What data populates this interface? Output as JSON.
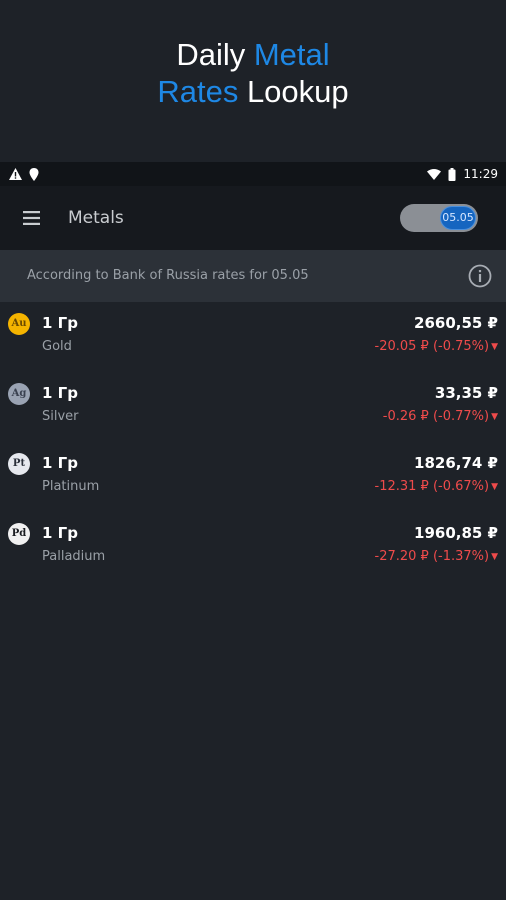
{
  "promo": {
    "line1_a": "Daily ",
    "line1_b": "Metal",
    "line2_a": "Rates",
    "line2_b": " Lookup"
  },
  "status": {
    "time": "11:29"
  },
  "appbar": {
    "title": "Metals",
    "date_toggle": "05.05"
  },
  "info": {
    "text": "According to Bank of Russia rates for 05.05"
  },
  "metals": [
    {
      "symbol": "Au",
      "qty": "1 Гр",
      "name": "Gold",
      "price": "2660,55 ₽",
      "change": "-20.05 ₽ (-0.75%)",
      "badge_bg": "#f5b400",
      "badge_fg": "#6b4a00"
    },
    {
      "symbol": "Ag",
      "qty": "1 Гр",
      "name": "Silver",
      "price": "33,35 ₽",
      "change": "-0.26 ₽ (-0.77%)",
      "badge_bg": "#9aa3b3",
      "badge_fg": "#3a4150"
    },
    {
      "symbol": "Pt",
      "qty": "1 Гр",
      "name": "Platinum",
      "price": "1826,74 ₽",
      "change": "-12.31 ₽ (-0.67%)",
      "badge_bg": "#e6e8ee",
      "badge_fg": "#2a2f3a"
    },
    {
      "symbol": "Pd",
      "qty": "1 Гр",
      "name": "Palladium",
      "price": "1960,85 ₽",
      "change": "-27.20 ₽ (-1.37%)",
      "badge_bg": "#f1f1f1",
      "badge_fg": "#1a1d22"
    }
  ],
  "colors": {
    "accent": "#1e88e5",
    "negative": "#ef4b4b",
    "background": "#1e2228"
  }
}
